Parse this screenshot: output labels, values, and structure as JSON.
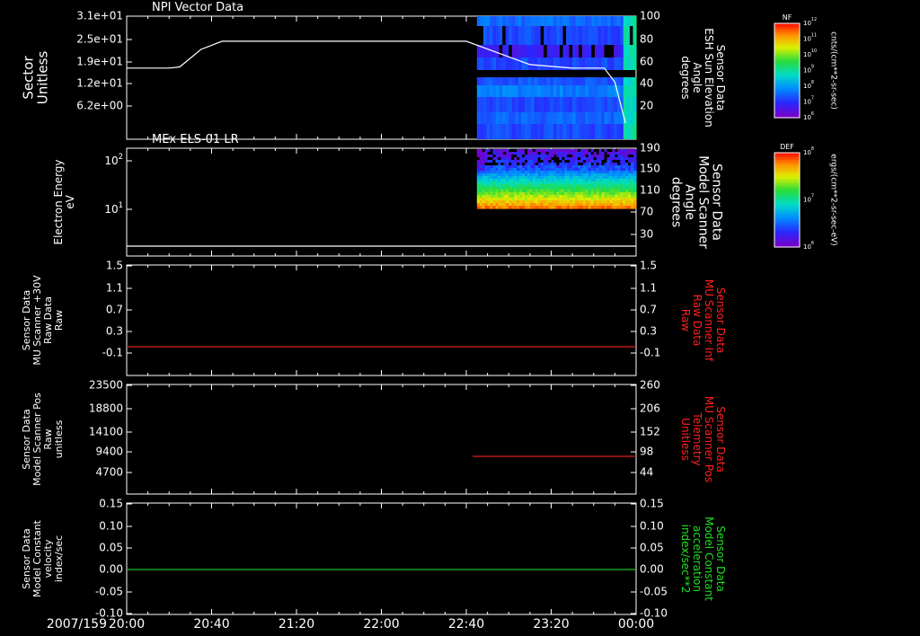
{
  "date_label": "2007/159",
  "time_ticks": [
    "20:00",
    "20:40",
    "21:20",
    "22:00",
    "22:40",
    "23:20",
    "00:00"
  ],
  "panels": [
    {
      "id": "npi",
      "title": "NPI Vector Data",
      "left_label": [
        "Sector",
        "Unitless"
      ],
      "right_label": [
        "Sensor Data",
        "ESH Sun Elevation",
        "Angle",
        "degrees"
      ],
      "right_label_color": "#ffffff",
      "left_ticks": [
        "3.1e+01",
        "2.5e+01",
        "1.9e+01",
        "1.2e+01",
        "6.2e+00"
      ],
      "right_ticks": [
        "100",
        "80",
        "60",
        "40",
        "20"
      ]
    },
    {
      "id": "els",
      "title": "MEx ELS-01 LR",
      "left_label": [
        "Electron Energy",
        "eV"
      ],
      "left_ticks": [
        "10^2",
        "10^1"
      ],
      "right_label": [
        "Sensor Data",
        "Model Scanner",
        "Angle",
        "degrees"
      ],
      "right_label_color": "#ffffff",
      "right_ticks": [
        "190",
        "150",
        "110",
        "70",
        "30"
      ]
    },
    {
      "id": "mu_raw",
      "title": "",
      "left_label": [
        "Sensor Data",
        "MU Scanner +30V",
        "Raw Data",
        "Raw"
      ],
      "right_label": [
        "Sensor Data",
        "MU Scanner Inf",
        "Raw Data",
        "Raw"
      ],
      "right_label_color": "#ff2020",
      "left_ticks": [
        "1.5",
        "1.1",
        "0.7",
        "0.3",
        "-0.1"
      ],
      "right_ticks": [
        "1.5",
        "1.1",
        "0.7",
        "0.3",
        "-0.1"
      ]
    },
    {
      "id": "mu_pos",
      "title": "",
      "left_label": [
        "Sensor Data",
        "Model Scanner Pos",
        "Raw",
        "unitless"
      ],
      "right_label": [
        "Sensor Data",
        "MU Scanner Pos",
        "Telemetry",
        "Unitless"
      ],
      "right_label_color": "#ff2020",
      "left_ticks": [
        "23500",
        "18800",
        "14100",
        "9400",
        "4700"
      ],
      "right_ticks": [
        "260",
        "206",
        "152",
        "98",
        "44"
      ]
    },
    {
      "id": "model_const",
      "title": "",
      "left_label": [
        "Sensor Data",
        "Model Constant",
        "velocity",
        "index/sec"
      ],
      "right_label": [
        "Sensor Data",
        "Model Constant",
        "acceleration",
        "index/sec**2"
      ],
      "right_label_color": "#20e020",
      "left_ticks": [
        "0.15",
        "0.10",
        "0.05",
        "0.00",
        "-0.05",
        "-0.10"
      ],
      "right_ticks": [
        "0.15",
        "0.10",
        "0.05",
        "0.00",
        "-0.05",
        "-0.10"
      ]
    }
  ],
  "colorbars": [
    {
      "title": "NF",
      "ticks": [
        "10^12",
        "10^11",
        "10^10",
        "10^9",
        "10^8",
        "10^7",
        "10^6"
      ],
      "units": "cnts/(cm**2-sr-sec)"
    },
    {
      "title": "DEF",
      "ticks": [
        "10^8",
        "10^7",
        "10^6"
      ],
      "units": "ergs/(cm**2-sr-sec-eV)"
    }
  ],
  "chart_data": [
    {
      "type": "line",
      "panel": "NPI Vector Data",
      "x_range": [
        "20:00",
        "00:00"
      ],
      "ylim_right": [
        0,
        100
      ],
      "series": [
        {
          "name": "ESH Sun Elevation Angle",
          "x": [
            "20:00",
            "20:20",
            "20:25",
            "20:35",
            "20:45",
            "21:00",
            "21:30",
            "22:00",
            "22:30",
            "22:40",
            "22:55",
            "23:10",
            "23:30",
            "23:45",
            "23:50",
            "23:55"
          ],
          "y": [
            57,
            57,
            58,
            73,
            80,
            80,
            80,
            80,
            80,
            80,
            70,
            60,
            57,
            57,
            45,
            10
          ]
        }
      ],
      "spectrogram": {
        "start": "22:45",
        "end": "00:00",
        "ylim_left": [
          0,
          31
        ]
      }
    },
    {
      "type": "heatmap",
      "panel": "MEx ELS-01 LR",
      "x_range": [
        "22:45",
        "00:00"
      ],
      "ylim": [
        1,
        200
      ],
      "yscale": "log",
      "series": [
        {
          "name": "Model Scanner Angle",
          "x": [
            "20:00",
            "00:00"
          ],
          "y": [
            10,
            10
          ]
        }
      ]
    },
    {
      "type": "line",
      "panel": "MU Scanner Raw",
      "ylim": [
        -0.3,
        1.5
      ],
      "series": [
        {
          "x": [
            "20:00",
            "00:00"
          ],
          "y": [
            0.0,
            0.0
          ],
          "color": "#e02020"
        }
      ]
    },
    {
      "type": "line",
      "panel": "MU Scanner Pos",
      "ylim_right": [
        0,
        260
      ],
      "series": [
        {
          "x": [
            "22:43",
            "00:00"
          ],
          "y": [
            90,
            90
          ],
          "color": "#e02020"
        }
      ]
    },
    {
      "type": "line",
      "panel": "Model Constant",
      "ylim": [
        -0.1,
        0.15
      ],
      "series": [
        {
          "x": [
            "20:00",
            "00:00"
          ],
          "y": [
            0.0,
            0.0
          ],
          "color": "#20c020"
        }
      ]
    }
  ]
}
